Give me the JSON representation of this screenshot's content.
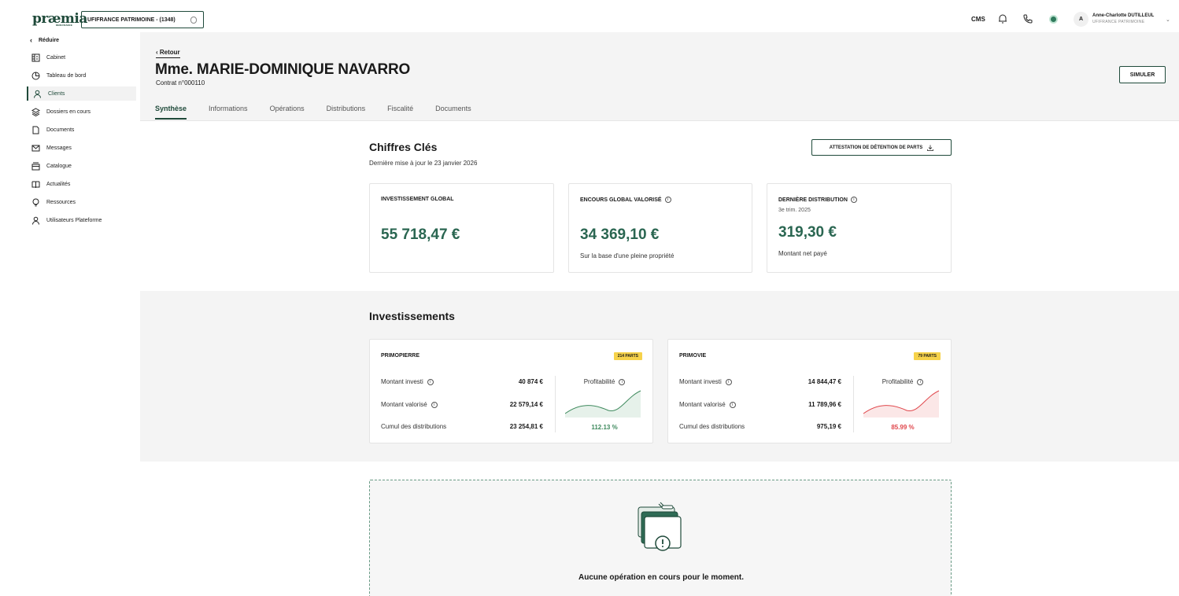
{
  "topbar": {
    "logo": "præmia",
    "logo_tag": "REIM FRANCE",
    "org_select": "UFIFRANCE PATRIMOINE - (1348)",
    "cms": "CMS",
    "avatar_initial": "A",
    "user_name": "Anne-Charlotte DUTILLEUL",
    "user_org": "UFIFRANCE PATRIMOINE"
  },
  "sidebar": {
    "reduce_label": "Réduire",
    "items": [
      {
        "label": "Cabinet",
        "icon": "building-icon"
      },
      {
        "label": "Tableau de bord",
        "icon": "dashboard-icon"
      },
      {
        "label": "Clients",
        "icon": "user-icon",
        "active": true
      },
      {
        "label": "Dossiers en cours",
        "icon": "layers-icon"
      },
      {
        "label": "Documents",
        "icon": "document-icon"
      },
      {
        "label": "Messages",
        "icon": "mail-icon"
      },
      {
        "label": "Catalogue",
        "icon": "catalogue-icon"
      },
      {
        "label": "Actualités",
        "icon": "book-icon"
      },
      {
        "label": "Ressources",
        "icon": "lightbulb-icon"
      },
      {
        "label": "Utilisateurs Plateforme",
        "icon": "user-icon"
      }
    ]
  },
  "header": {
    "back_label": "Retour",
    "client_name": "Mme. MARIE-DOMINIQUE NAVARRO",
    "contract": "Contrat n°000110",
    "simulate_label": "SIMULER",
    "tabs": [
      "Synthèse",
      "Informations",
      "Opérations",
      "Distributions",
      "Fiscalité",
      "Documents"
    ],
    "active_tab": "Synthèse"
  },
  "key_figures": {
    "title": "Chiffres Clés",
    "updated": "Dernière mise à jour le 23 janvier 2026",
    "attestation_label": "ATTESTATION DE DÉTENTION DE PARTS",
    "cards": [
      {
        "title": "INVESTISSEMENT GLOBAL",
        "subtitle": "",
        "value": "55 718,47 €",
        "note": ""
      },
      {
        "title": "ENCOURS GLOBAL VALORISÉ",
        "subtitle": "",
        "value": "34 369,10 €",
        "note": "Sur la base d'une pleine propriété"
      },
      {
        "title": "DERNIÈRE DISTRIBUTION",
        "subtitle": "3e trim. 2025",
        "value": "319,30 €",
        "note": "Montant net payé"
      }
    ]
  },
  "investments": {
    "title": "Investissements",
    "labels": {
      "invested": "Montant investi",
      "valued": "Montant valorisé",
      "distributions": "Cumul des distributions",
      "profitability": "Profitabilité"
    },
    "funds": [
      {
        "name": "PRIMOPIERRE",
        "badge": "214 PARTS",
        "invested": "40 874 €",
        "valued": "22 579,14 €",
        "distributions": "23 254,81 €",
        "profitability": "112.13 %",
        "trend_color": "#3f8a5e"
      },
      {
        "name": "PRIMOVIE",
        "badge": "79 PARTS",
        "invested": "14 844,47 €",
        "valued": "11 789,96 €",
        "distributions": "975,19 €",
        "profitability": "85.99 %",
        "trend_color": "#e0474c"
      }
    ]
  },
  "operations": {
    "empty_title": "Aucune opération en cours pour le moment."
  }
}
